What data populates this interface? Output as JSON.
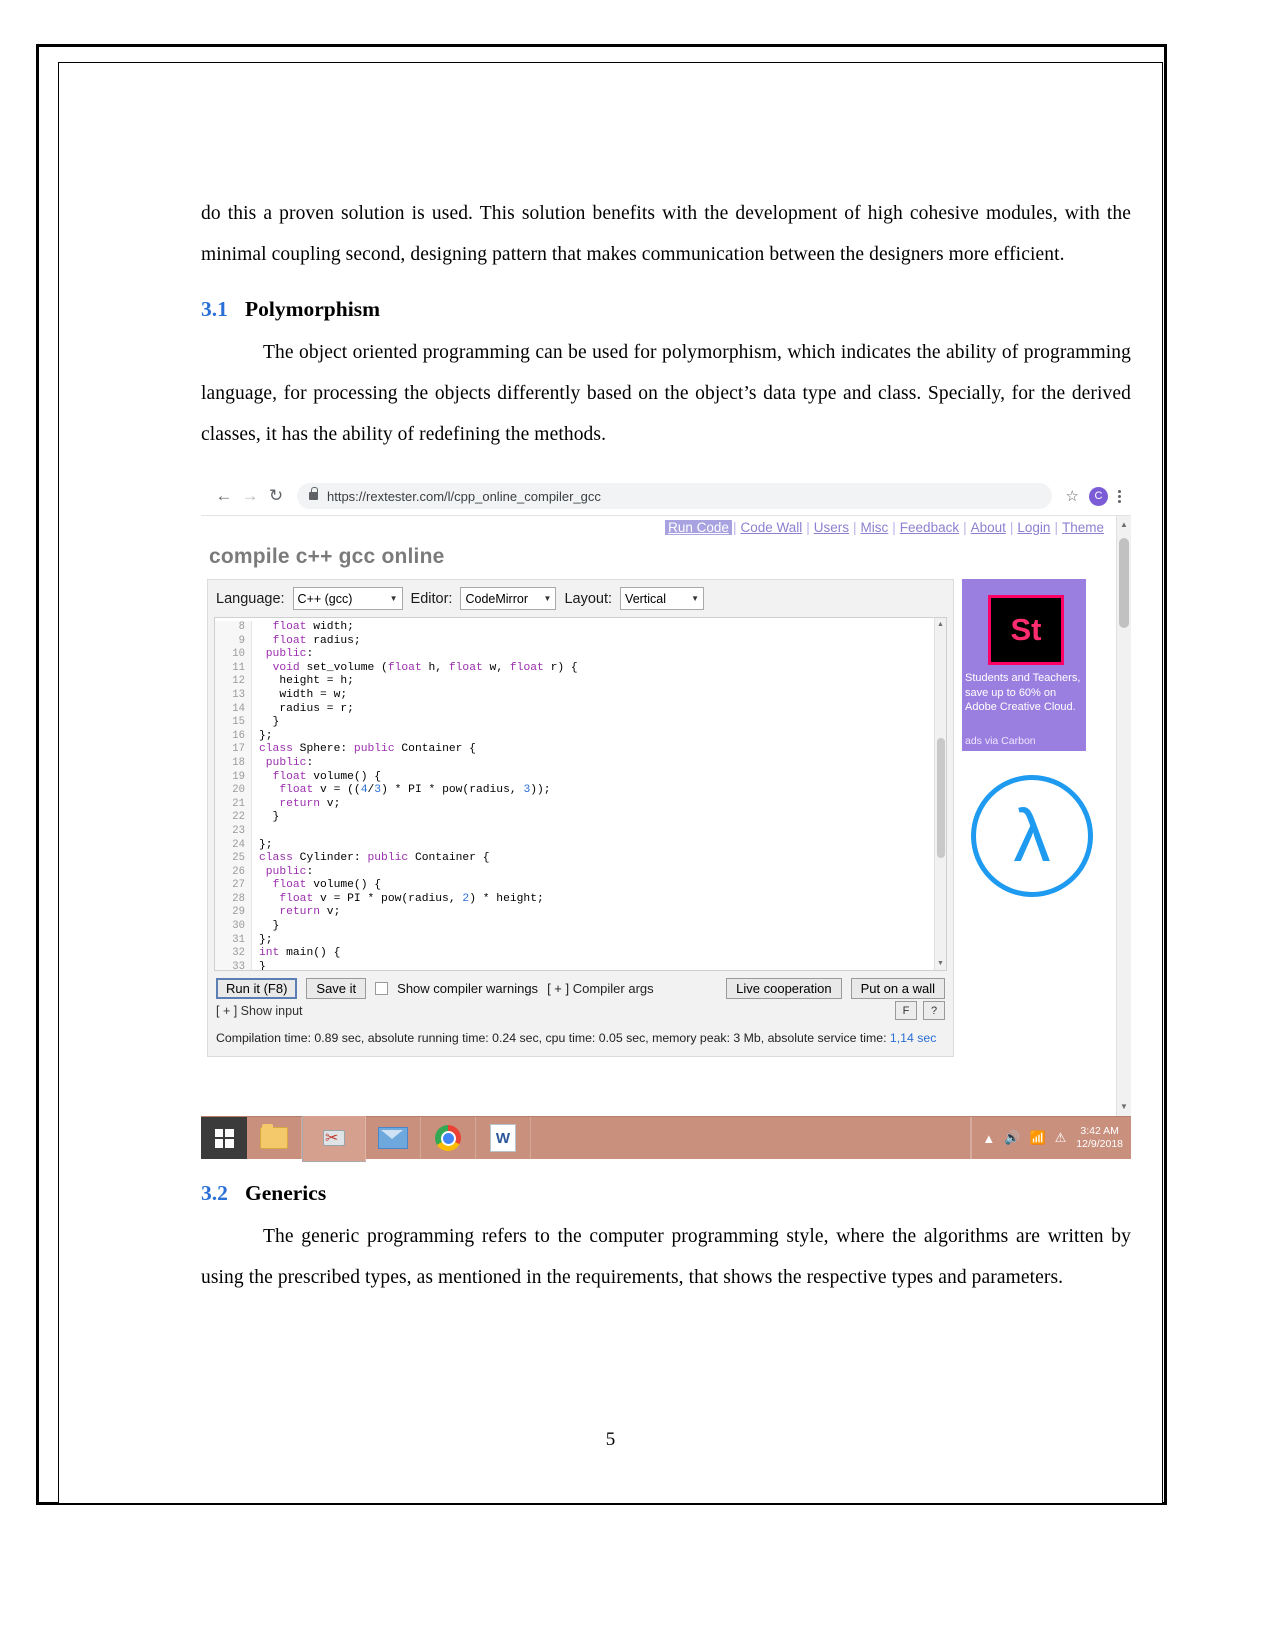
{
  "document": {
    "paragraphs": {
      "intro": "do this a proven solution is used. This solution benefits with the development of high cohesive modules, with the minimal coupling second, designing pattern that makes communication between the designers more efficient.",
      "polymorphism_body": "The object oriented programming can be used for polymorphism, which indicates the ability of programming language, for processing the objects differently based on the object’s data type and class. Specially, for the derived classes, it has the ability of redefining the methods.",
      "generics_body": "The generic programming refers to the computer programming style, where the algorithms are written by using the prescribed types, as mentioned in the requirements, that shows the respective types and parameters."
    },
    "headings": {
      "polymorphism_num": "3.1",
      "polymorphism_text": "Polymorphism",
      "generics_num": "3.2",
      "generics_text": "Generics"
    },
    "page_number": "5"
  },
  "browser": {
    "back_icon": "←",
    "forward_icon": "→",
    "reload_icon": "↻",
    "lock_icon": "lock-icon",
    "url": "https://rextester.com/l/cpp_online_compiler_gcc",
    "bookmark_icon": "☆",
    "profile_initial": "C",
    "menu_icon": "kebab-menu-icon"
  },
  "site": {
    "title": "compile c++ gcc online",
    "nav": [
      {
        "label": "Run Code",
        "active": true
      },
      {
        "label": "Code Wall",
        "active": false
      },
      {
        "label": "Users",
        "active": false
      },
      {
        "label": "Misc",
        "active": false
      },
      {
        "label": "Feedback",
        "active": false
      },
      {
        "label": "About",
        "active": false
      },
      {
        "label": "Login",
        "active": false
      },
      {
        "label": "Theme",
        "active": false
      }
    ],
    "toolbar": {
      "language_label": "Language:",
      "language_value": "C++ (gcc)",
      "editor_label": "Editor:",
      "editor_value": "CodeMirror",
      "layout_label": "Layout:",
      "layout_value": "Vertical",
      "arrow_icon": "▼"
    },
    "code_lines": [
      {
        "no": "8",
        "src": "  float width;"
      },
      {
        "no": "9",
        "src": "  float radius;"
      },
      {
        "no": "10",
        "src": " public:"
      },
      {
        "no": "11",
        "src": "  void set_volume (float h, float w, float r) {"
      },
      {
        "no": "12",
        "src": "   height = h;"
      },
      {
        "no": "13",
        "src": "   width = w;"
      },
      {
        "no": "14",
        "src": "   radius = r;"
      },
      {
        "no": "15",
        "src": "  }"
      },
      {
        "no": "16",
        "src": "};"
      },
      {
        "no": "17",
        "src": "class Sphere: public Container {"
      },
      {
        "no": "18",
        "src": " public:"
      },
      {
        "no": "19",
        "src": "  float volume() {"
      },
      {
        "no": "20",
        "src": "   float v = ((4/3) * PI * pow(radius, 3));"
      },
      {
        "no": "21",
        "src": "   return v;"
      },
      {
        "no": "22",
        "src": "  }"
      },
      {
        "no": "23",
        "src": ""
      },
      {
        "no": "24",
        "src": "};"
      },
      {
        "no": "25",
        "src": "class Cylinder: public Container {"
      },
      {
        "no": "26",
        "src": " public:"
      },
      {
        "no": "27",
        "src": "  float volume() {"
      },
      {
        "no": "28",
        "src": "   float v = PI * pow(radius, 2) * height;"
      },
      {
        "no": "29",
        "src": "   return v;"
      },
      {
        "no": "30",
        "src": "  }"
      },
      {
        "no": "31",
        "src": "};"
      },
      {
        "no": "32",
        "src": "int main() {"
      },
      {
        "no": "33",
        "src": "}"
      }
    ],
    "buttons": {
      "run": "Run it (F8)",
      "save": "Save it",
      "show_warnings": "Show compiler warnings",
      "compiler_args": "[ + ] Compiler args",
      "live_cooperation": "Live cooperation",
      "put_on_wall": "Put on a wall",
      "f_button": "F",
      "help_button": "?",
      "show_input": "[ + ] Show input"
    },
    "compilation_info": "Compilation time: 0.89 sec, absolute running time: 0.24 sec, cpu time: 0.05 sec, memory peak: 3 Mb, absolute service time: ",
    "compilation_info_highlight": "1,14 sec",
    "ad": {
      "logo_text": "St",
      "body": "Students and Teachers, save up to 60% on Adobe Creative Cloud.",
      "credit": "ads via Carbon",
      "lambda_glyph": "λ"
    },
    "scroll_up_icon": "▲",
    "scroll_down_icon": "▼"
  },
  "taskbar": {
    "start_icon": "windows-icon",
    "items": [
      {
        "icon": "file-explorer-icon"
      },
      {
        "icon": "snipping-tool-icon"
      },
      {
        "icon": "mail-icon"
      },
      {
        "icon": "chrome-icon"
      },
      {
        "icon": "word-icon"
      }
    ],
    "tray": {
      "chevron_icon": "▲",
      "volume_icon": "🔊",
      "network_icon": "📶",
      "shield_icon": "⚠",
      "time": "3:42 AM",
      "date": "12/9/2018"
    }
  }
}
